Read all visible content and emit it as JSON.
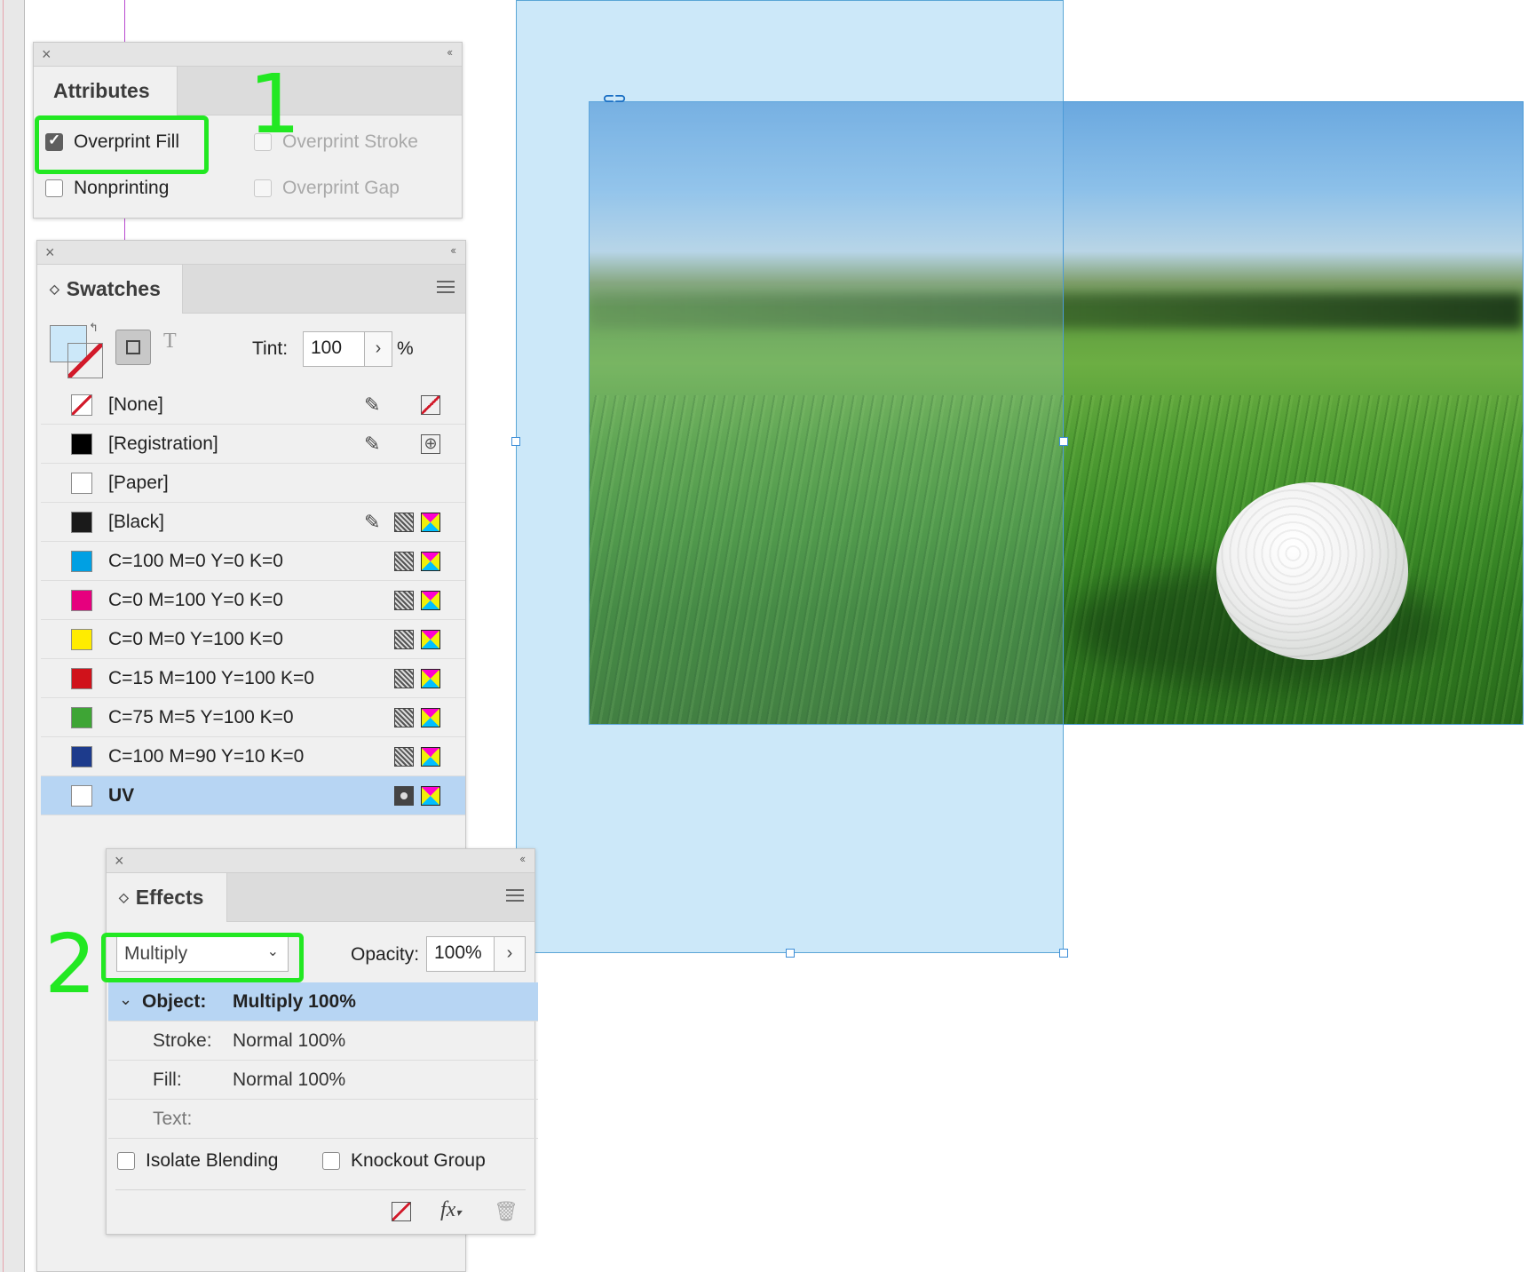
{
  "attributes_panel": {
    "tab": "Attributes",
    "options": [
      {
        "label": "Overprint Fill",
        "checked": true,
        "enabled": true
      },
      {
        "label": "Overprint Stroke",
        "checked": false,
        "enabled": false
      },
      {
        "label": "Nonprinting",
        "checked": false,
        "enabled": true
      },
      {
        "label": "Overprint Gap",
        "checked": false,
        "enabled": false
      }
    ]
  },
  "swatches_panel": {
    "tab": "Swatches",
    "tint_label": "Tint:",
    "tint_value": "100",
    "tint_unit": "%",
    "type_icon": "T",
    "swatches": [
      {
        "name": "[None]",
        "color": "none"
      },
      {
        "name": "[Registration]",
        "color": "#000000"
      },
      {
        "name": "[Paper]",
        "color": "#ffffff"
      },
      {
        "name": "[Black]",
        "color": "#1a1a1a"
      },
      {
        "name": "C=100 M=0 Y=0 K=0",
        "color": "#00a0e3"
      },
      {
        "name": "C=0 M=100 Y=0 K=0",
        "color": "#e6007e"
      },
      {
        "name": "C=0 M=0 Y=100 K=0",
        "color": "#ffec00"
      },
      {
        "name": "C=15 M=100 Y=100 K=0",
        "color": "#d0121b"
      },
      {
        "name": "C=75 M=5 Y=100 K=0",
        "color": "#3ea535"
      },
      {
        "name": "C=100 M=90 Y=10 K=0",
        "color": "#1d3b8c"
      },
      {
        "name": "UV",
        "color": "#ffffff",
        "selected": true
      }
    ]
  },
  "effects_panel": {
    "tab": "Effects",
    "blend_mode": "Multiply",
    "opacity_label": "Opacity:",
    "opacity_value": "100%",
    "rows": [
      {
        "key": "Object:",
        "value": "Multiply 100%",
        "selected": true
      },
      {
        "key": "Stroke:",
        "value": "Normal 100%"
      },
      {
        "key": "Fill:",
        "value": "Normal 100%"
      },
      {
        "key": "Text:",
        "value": ""
      }
    ],
    "isolate_blending": "Isolate Blending",
    "knockout_group": "Knockout Group",
    "fx_label": "fx"
  },
  "annotations": [
    "1",
    "2"
  ],
  "colors": {
    "highlight_green": "#22e822",
    "selection_blue": "#b7d5f3",
    "frame_fill": "#cce8f9"
  }
}
